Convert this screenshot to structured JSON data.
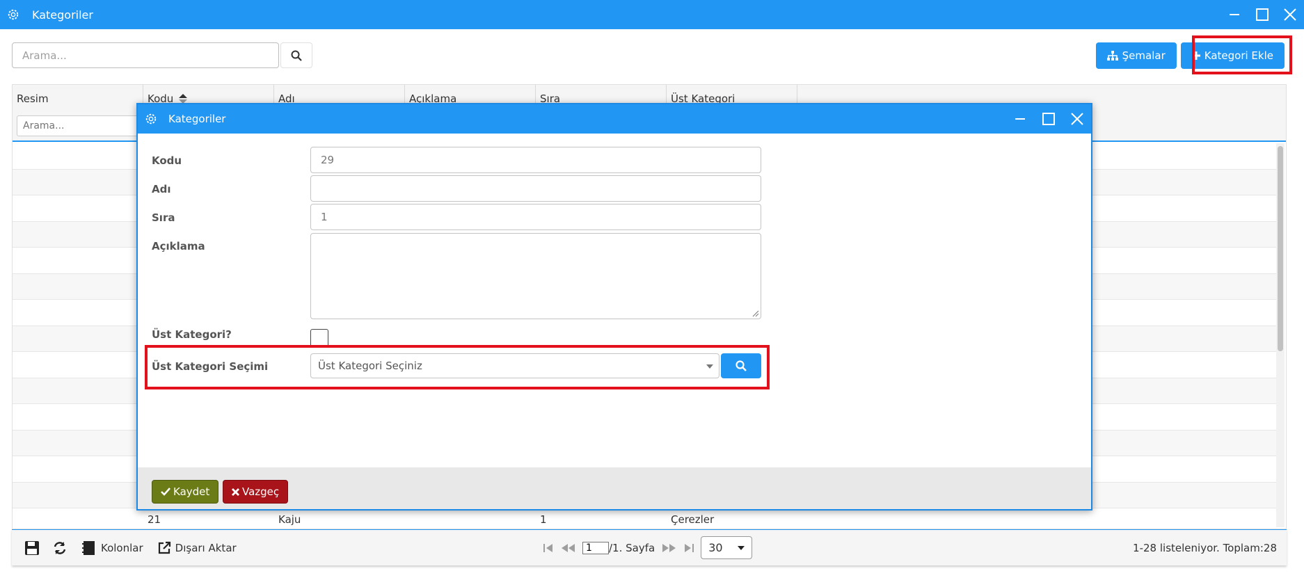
{
  "window": {
    "title": "Kategoriler",
    "accent": "#2196f3"
  },
  "toolbar": {
    "search_placeholder": "Arama...",
    "schemas_label": "Şemalar",
    "add_category_label": "Kategori Ekle"
  },
  "grid": {
    "columns": [
      "Resim",
      "Kodu",
      "Adı",
      "Açıklama",
      "Sıra",
      "Üst Kategori"
    ],
    "filter_placeholder": "Arama...",
    "last_row": {
      "kodu": "21",
      "adi": "Kaju",
      "sira": "1",
      "ust_kategori": "Çerezler"
    }
  },
  "footer": {
    "columns_label": "Kolonlar",
    "export_label": "Dışarı Aktar",
    "page_value": "1",
    "page_suffix": "/1. Sayfa",
    "page_size": "30",
    "status": "1-28 listeleniyor. Toplam:28"
  },
  "modal": {
    "title": "Kategoriler",
    "fields": {
      "kodu_label": "Kodu",
      "kodu_value": "29",
      "adi_label": "Adı",
      "adi_value": "",
      "sira_label": "Sıra",
      "sira_value": "1",
      "aciklama_label": "Açıklama",
      "aciklama_value": "",
      "ust_kategori_label": "Üst Kategori?",
      "ust_kategori_secimi_label": "Üst Kategori Seçimi",
      "ust_kategori_secimi_value": "Üst Kategori Seçiniz"
    },
    "save_label": "Kaydet",
    "cancel_label": "Vazgeç"
  },
  "colors": {
    "save": "#6b7b16",
    "cancel": "#a8141a",
    "highlight": "#e3111c"
  }
}
